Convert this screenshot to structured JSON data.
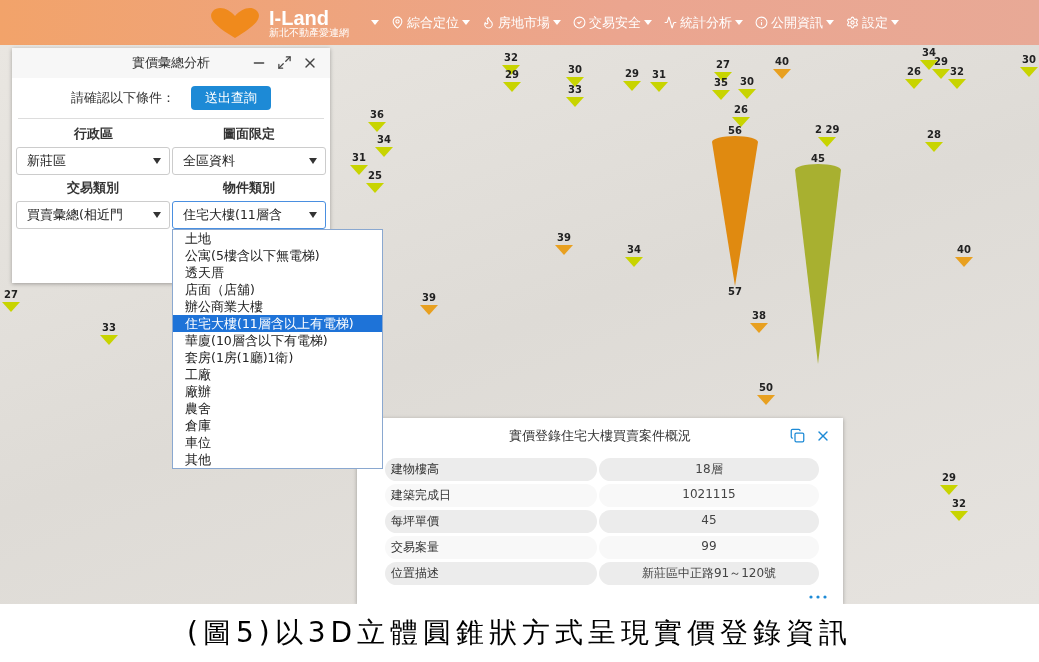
{
  "nav": {
    "logo_title": "I-Land",
    "logo_subtitle": "新北不動產愛連網",
    "menu": [
      {
        "label": "綜合定位"
      },
      {
        "label": "房地市場"
      },
      {
        "label": "交易安全"
      },
      {
        "label": "統計分析"
      },
      {
        "label": "公開資訊"
      },
      {
        "label": "設定"
      }
    ]
  },
  "map": {
    "cones": [
      {
        "top_label": "56",
        "base_label": "57",
        "color": "#e08a10"
      },
      {
        "top_label": "45",
        "color": "#a8b030"
      }
    ],
    "markers": [
      {
        "label": "32",
        "color": "#c8d400"
      },
      {
        "label": "29",
        "color": "#c8d400"
      },
      {
        "label": "30",
        "color": "#c8d400"
      },
      {
        "label": "33",
        "color": "#c8d400"
      },
      {
        "label": "29",
        "color": "#c8d400"
      },
      {
        "label": "31",
        "color": "#c8d400"
      },
      {
        "label": "27",
        "color": "#c8d400"
      },
      {
        "label": "35",
        "color": "#c8d400"
      },
      {
        "label": "30",
        "color": "#c8d400"
      },
      {
        "label": "40",
        "color": "#e8a020"
      },
      {
        "label": "26",
        "color": "#c8d400"
      },
      {
        "label": "29",
        "color": "#c8d400"
      },
      {
        "label": "32",
        "color": "#c8d400"
      },
      {
        "label": "34",
        "color": "#c8d400"
      },
      {
        "label": "30",
        "color": "#c8d400"
      },
      {
        "label": "26",
        "color": "#c8d400"
      },
      {
        "label": "2 29",
        "color": "#c8d400"
      },
      {
        "label": "28",
        "color": "#c8d400"
      },
      {
        "label": "36",
        "color": "#c8d400"
      },
      {
        "label": "34",
        "color": "#c8d400"
      },
      {
        "label": "31",
        "color": "#c8d400"
      },
      {
        "label": "25",
        "color": "#c8d400"
      },
      {
        "label": "39",
        "color": "#e8a020"
      },
      {
        "label": "34",
        "color": "#c8d400"
      },
      {
        "label": "40",
        "color": "#e8a020"
      },
      {
        "label": "39",
        "color": "#e8a020"
      },
      {
        "label": "33",
        "color": "#c8d400"
      },
      {
        "label": "38",
        "color": "#e8a020"
      },
      {
        "label": "50",
        "color": "#e8a020"
      },
      {
        "label": "29",
        "color": "#c8d400"
      },
      {
        "label": "32",
        "color": "#c8d400"
      },
      {
        "label": "27",
        "color": "#c8d400"
      }
    ]
  },
  "query_panel": {
    "title": "實價彙總分析",
    "prompt": "請確認以下條件：",
    "submit": "送出查詢",
    "fields": [
      {
        "label": "行政區",
        "value": "新莊區",
        "open": false
      },
      {
        "label": "圖面限定",
        "value": "全區資料",
        "open": false
      },
      {
        "label": "交易類別",
        "value": "買賣彙總(相近門",
        "open": false
      },
      {
        "label": "物件類別",
        "value": "住宅大樓(11層含",
        "open": true
      }
    ],
    "options": [
      {
        "label": "土地",
        "selected": false
      },
      {
        "label": "公寓(5樓含以下無電梯)",
        "selected": false
      },
      {
        "label": "透天厝",
        "selected": false
      },
      {
        "label": "店面（店舖)",
        "selected": false
      },
      {
        "label": "辦公商業大樓",
        "selected": false
      },
      {
        "label": "住宅大樓(11層含以上有電梯)",
        "selected": true
      },
      {
        "label": "華廈(10層含以下有電梯)",
        "selected": false
      },
      {
        "label": "套房(1房(1廳)1衛)",
        "selected": false
      },
      {
        "label": "工廠",
        "selected": false
      },
      {
        "label": "廠辦",
        "selected": false
      },
      {
        "label": "農舍",
        "selected": false
      },
      {
        "label": "倉庫",
        "selected": false
      },
      {
        "label": "車位",
        "selected": false
      },
      {
        "label": "其他",
        "selected": false
      }
    ]
  },
  "info_panel": {
    "title": "實價登錄住宅大樓買賣案件概況",
    "rows": [
      {
        "label": "建物樓高",
        "value": "18層"
      },
      {
        "label": "建築完成日",
        "value": "1021115"
      },
      {
        "label": "每坪單價",
        "value": "45"
      },
      {
        "label": "交易案量",
        "value": "99"
      },
      {
        "label": "位置描述",
        "value": "新莊區中正路91～120號"
      }
    ]
  },
  "caption": "(圖5)以3D立體圓錐狀方式呈現實價登錄資訊"
}
